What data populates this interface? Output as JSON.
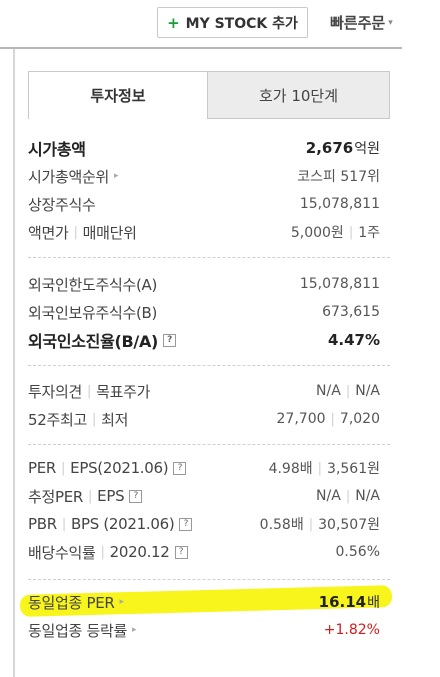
{
  "header": {
    "mystock_label": "MY STOCK 추가",
    "plus_symbol": "+",
    "quick_order_label": "빠른주문"
  },
  "tabs": [
    {
      "label": "투자정보",
      "active": true
    },
    {
      "label": "호가 10단계",
      "active": false
    }
  ],
  "market": {
    "market_cap_label": "시가총액",
    "market_cap_value": "2,676",
    "market_cap_unit": "억원",
    "cap_rank_label": "시가총액순위",
    "cap_rank_value": "코스피 517위",
    "listed_shares_label": "상장주식수",
    "listed_shares_value": "15,078,811",
    "par_label_a": "액면가",
    "par_label_b": "매매단위",
    "par_value_a": "5,000원",
    "par_value_b": "1주"
  },
  "foreign": {
    "limit_label": "외국인한도주식수(A)",
    "limit_value": "15,078,811",
    "holding_label": "외국인보유주식수(B)",
    "holding_value": "673,615",
    "ratio_label": "외국인소진율(B/A)",
    "ratio_value": "4.47%"
  },
  "opinion": {
    "label_a": "투자의견",
    "label_b": "목표주가",
    "value_a": "N/A",
    "value_b": "N/A",
    "week52_label_a": "52주최고",
    "week52_label_b": "최저",
    "week52_high": "27,700",
    "week52_low": "7,020"
  },
  "valuation": {
    "per_label_a": "PER",
    "per_label_b": "EPS(2021.06)",
    "per_value": "4.98배",
    "eps_value": "3,561원",
    "est_label_a": "추정PER",
    "est_label_b": "EPS",
    "est_per_value": "N/A",
    "est_eps_value": "N/A",
    "pbr_label_a": "PBR",
    "pbr_label_b": "BPS (2021.06)",
    "pbr_value": "0.58배",
    "bps_value": "30,507원",
    "div_label_a": "배당수익률",
    "div_label_b": "2020.12",
    "div_value": "0.56%"
  },
  "industry": {
    "per_label": "동일업종 PER",
    "per_value": "16.14",
    "per_unit": "배",
    "change_label": "동일업종 등락률",
    "change_value": "+1.82%"
  },
  "icons": {
    "help": "?",
    "arrow": "▸",
    "caret": "▾"
  },
  "colors": {
    "plus_green": "#1a9e3a",
    "up_red": "#d51c1c",
    "highlight": "#f7f51b"
  }
}
